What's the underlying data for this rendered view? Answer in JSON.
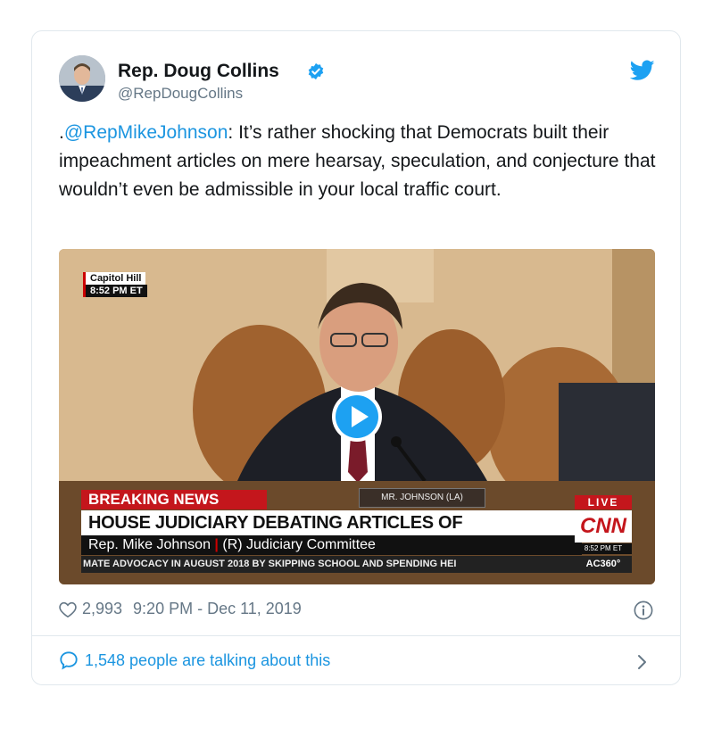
{
  "tweet": {
    "author_name": "Rep. Doug Collins",
    "handle": "@RepDougCollins",
    "mention": "@RepMikeJohnson",
    "text_prefix": ".",
    "text_body": ": It’s rather shocking that Democrats built their impeachment articles on mere hearsay, speculation, and conjecture that wouldn’t even be admissible in your local traffic court.",
    "likes": "2,993",
    "timestamp": "9:20 PM - Dec 11, 2019",
    "talking": "1,548 people are talking about this"
  },
  "video": {
    "location": "Capitol Hill",
    "location_time": "8:52 PM ET",
    "breaking": "BREAKING NEWS",
    "nameplate": "MR. JOHNSON (LA)",
    "headline": "HOUSE JUDICIARY DEBATING ARTICLES OF IMPEACHMENT",
    "sub_name": "Rep. Mike Johnson",
    "sub_role": "(R) Judiciary Committee",
    "ticker": "MATE ADVOCACY IN AUGUST 2018 BY SKIPPING SCHOOL AND SPENDING HEI",
    "live": "LIVE",
    "network": "CNN",
    "network_time": "8:52 PM ET",
    "show": "AC360°"
  },
  "icons": {
    "verified": "verified-badge-icon",
    "bird": "twitter-bird-icon",
    "heart": "heart-icon",
    "info": "info-icon",
    "comment": "comment-bubble-icon",
    "chevron": "chevron-right-icon",
    "play": "play-icon"
  },
  "colors": {
    "twitter_blue": "#1da1f2",
    "link_blue": "#1b95e0",
    "cnn_red": "#c4161c"
  }
}
